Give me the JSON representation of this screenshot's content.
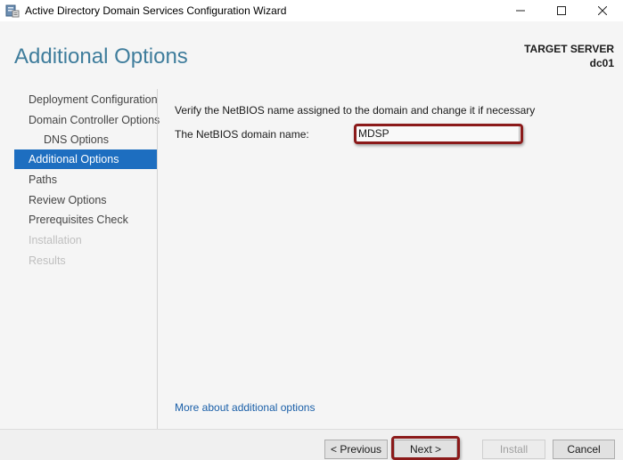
{
  "window": {
    "title": "Active Directory Domain Services Configuration Wizard",
    "icon": "server-manager-icon"
  },
  "header": {
    "page_title": "Additional Options",
    "target_server_label": "TARGET SERVER",
    "target_server_name": "dc01"
  },
  "nav": {
    "items": [
      {
        "label": "Deployment Configuration",
        "state": "normal"
      },
      {
        "label": "Domain Controller Options",
        "state": "normal"
      },
      {
        "label": "DNS Options",
        "state": "sub"
      },
      {
        "label": "Additional Options",
        "state": "active"
      },
      {
        "label": "Paths",
        "state": "normal"
      },
      {
        "label": "Review Options",
        "state": "normal"
      },
      {
        "label": "Prerequisites Check",
        "state": "normal"
      },
      {
        "label": "Installation",
        "state": "disabled"
      },
      {
        "label": "Results",
        "state": "disabled"
      }
    ]
  },
  "main": {
    "instruction": "Verify the NetBIOS name assigned to the domain and change it if necessary",
    "netbios_label": "The NetBIOS domain name:",
    "netbios_value": "MDSP",
    "more_link": "More about additional options"
  },
  "footer": {
    "previous": "< Previous",
    "next": "Next >",
    "install": "Install",
    "cancel": "Cancel"
  },
  "colors": {
    "accent": "#1d6ec0",
    "title": "#3f7d9c",
    "highlight": "#8b1a1a",
    "link": "#1a5fa8"
  }
}
